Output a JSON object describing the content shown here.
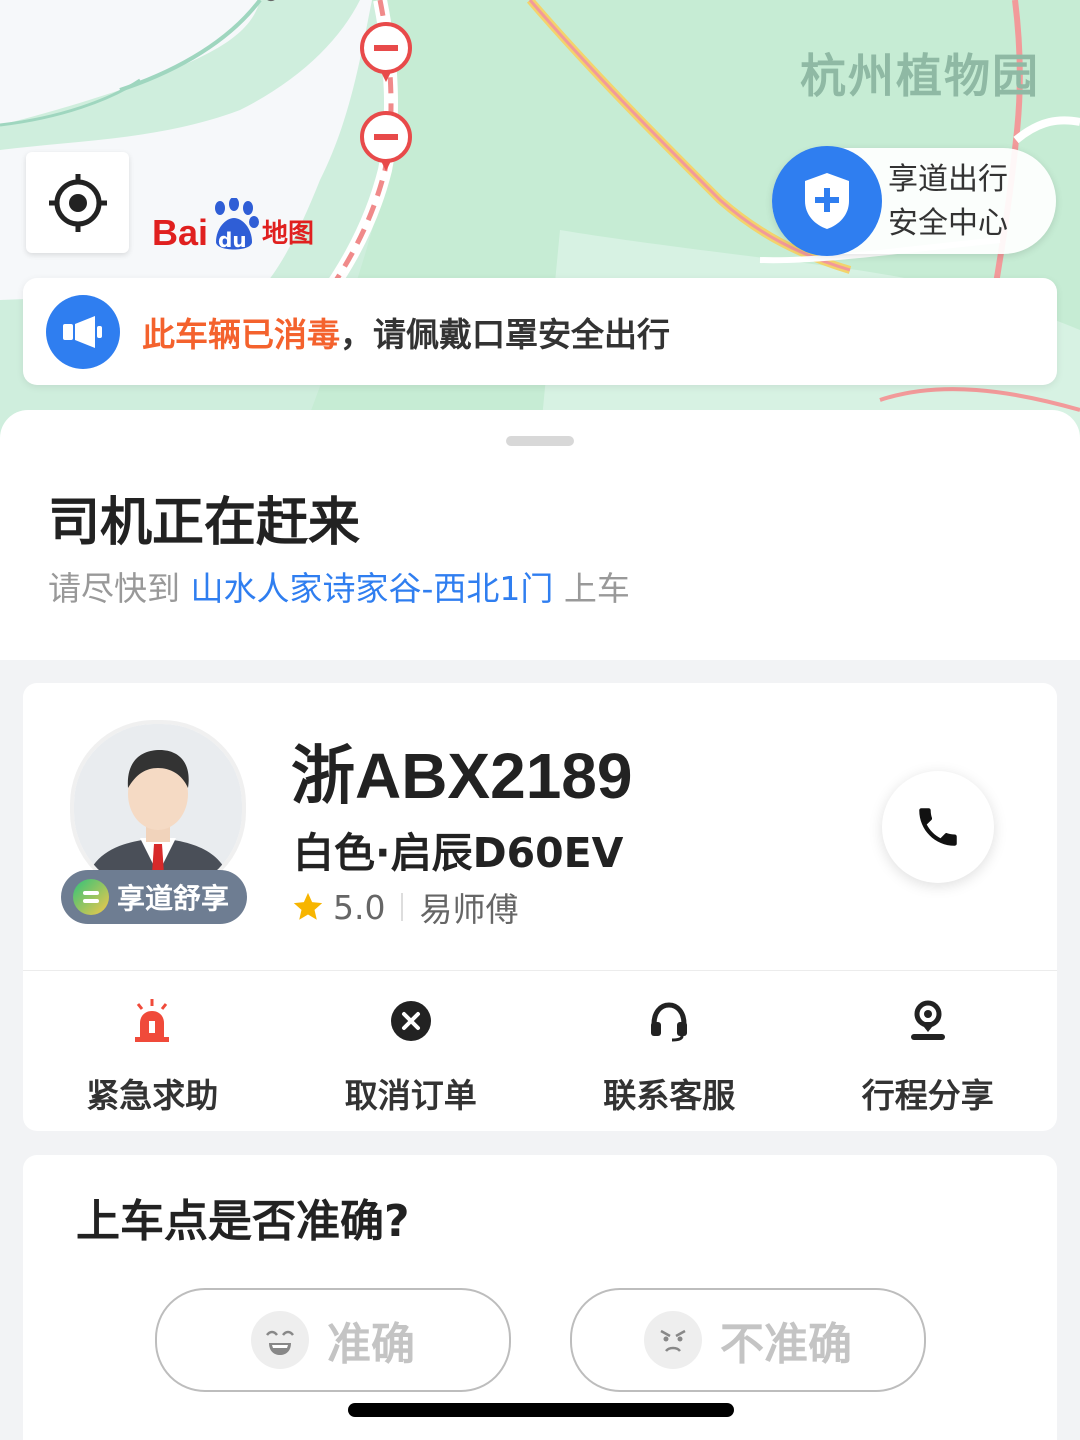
{
  "map": {
    "poi_label": "杭州植物园",
    "provider_logo_latin": "Bai",
    "provider_logo_du": "du",
    "provider_logo_cn": "地图",
    "safety_center": {
      "line1": "享道出行",
      "line2": "安全中心"
    },
    "notice": {
      "highlight": "此车辆已消毒",
      "rest": "，请佩戴口罩安全出行"
    }
  },
  "status": {
    "title": "司机正在赶来",
    "prefix": "请尽快到",
    "pickup_location": "山水人家诗家谷-西北1门",
    "suffix": "上车"
  },
  "driver": {
    "service_tier": "享道舒享",
    "plate": "浙ABX2189",
    "car": "白色·启辰D60EV",
    "rating": "5.0",
    "name": "易师傅"
  },
  "actions": [
    {
      "label": "紧急求助",
      "icon": "alarm-icon"
    },
    {
      "label": "取消订单",
      "icon": "cancel-icon"
    },
    {
      "label": "联系客服",
      "icon": "headset-icon"
    },
    {
      "label": "行程分享",
      "icon": "share-location-icon"
    }
  ],
  "feedback": {
    "question": "上车点是否准确?",
    "yes_label": "准确",
    "no_label": "不准确"
  },
  "colors": {
    "accent": "#2f7ef0",
    "notice_red": "#f4622d",
    "alarm_red": "#f04a3a",
    "star": "#f7b500"
  }
}
